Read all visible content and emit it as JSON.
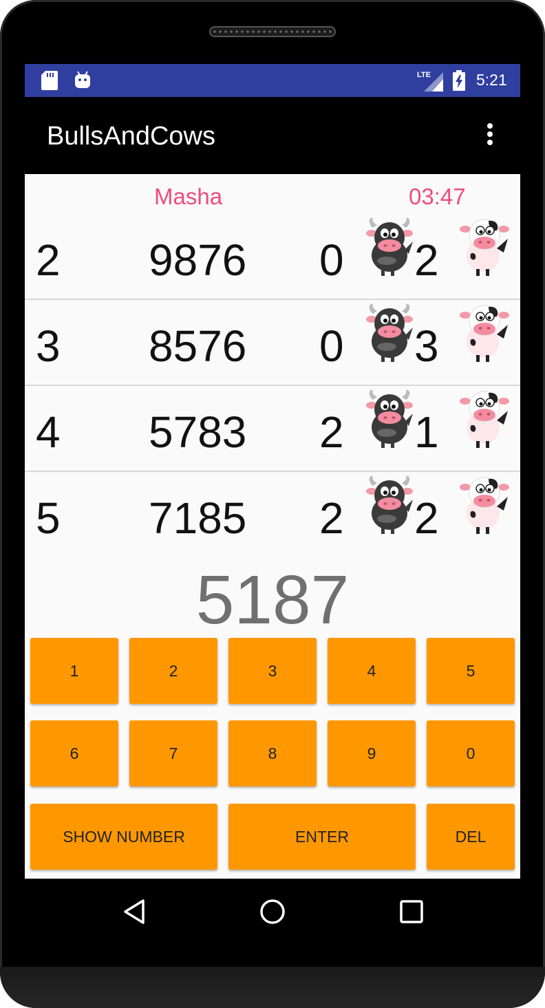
{
  "status_bar": {
    "time": "5:21",
    "icons": [
      "sd-card-icon",
      "android-icon",
      "lte-signal-icon",
      "battery-charging-icon"
    ]
  },
  "app_bar": {
    "title": "BullsAndCows",
    "menu_icon": "more-vertical-icon"
  },
  "header": {
    "player": "Masha",
    "timer": "03:47"
  },
  "guesses": [
    {
      "num": "2",
      "guess": "9876",
      "bulls": "0",
      "cows": "2"
    },
    {
      "num": "3",
      "guess": "8576",
      "bulls": "0",
      "cows": "3"
    },
    {
      "num": "4",
      "guess": "5783",
      "bulls": "2",
      "cows": "1"
    },
    {
      "num": "5",
      "guess": "7185",
      "bulls": "2",
      "cows": "2"
    }
  ],
  "current_guess": "5187",
  "keypad": {
    "row1": [
      "1",
      "2",
      "3",
      "4",
      "5"
    ],
    "row2": [
      "6",
      "7",
      "8",
      "9",
      "0"
    ],
    "show_number": "SHOW NUMBER",
    "enter": "ENTER",
    "del": "DEL"
  },
  "nav_bar": {
    "icons": [
      "back-triangle-icon",
      "home-circle-icon",
      "recents-square-icon"
    ]
  },
  "colors": {
    "status_bar": "#303f9f",
    "accent_pink": "#ee4c7c",
    "key_orange": "#ff9800",
    "guess_gray": "#707070"
  }
}
